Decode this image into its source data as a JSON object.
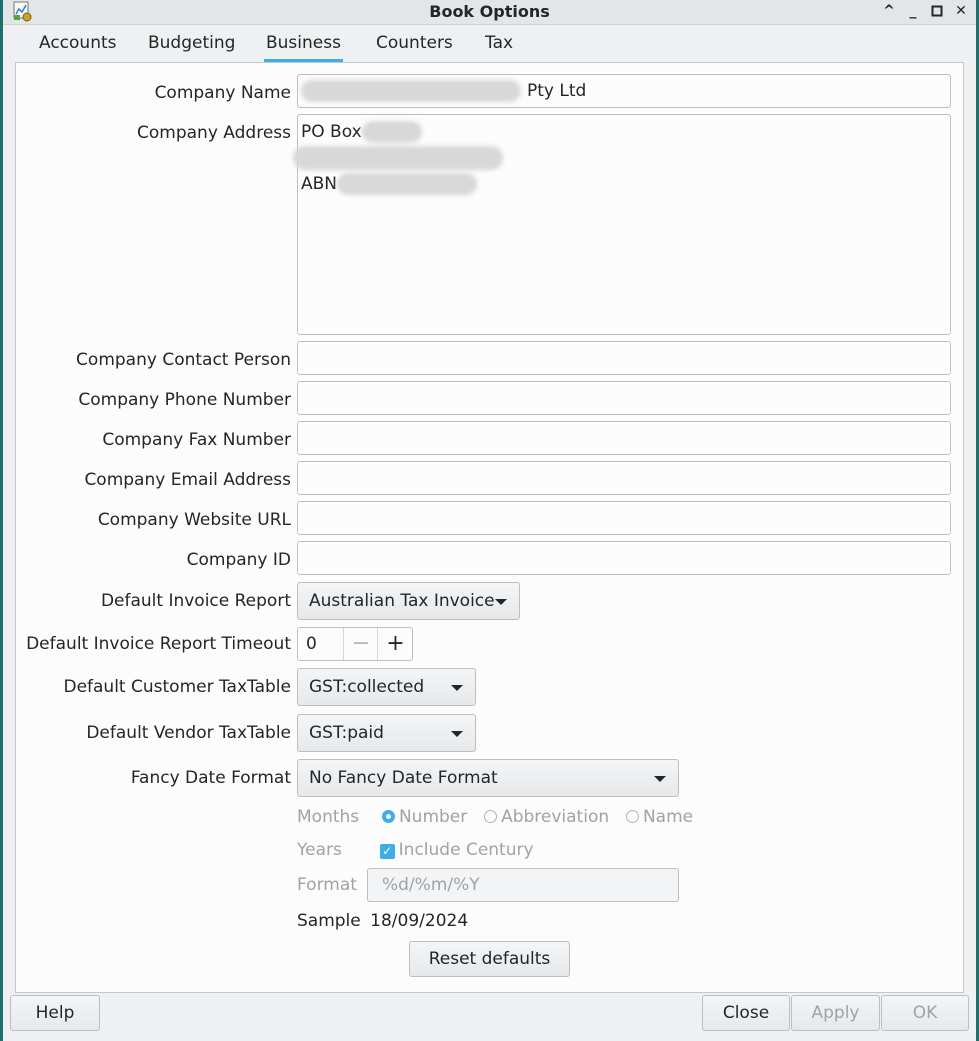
{
  "window": {
    "title": "Book Options"
  },
  "tabs": [
    {
      "label": "Accounts"
    },
    {
      "label": "Budgeting"
    },
    {
      "label": "Business"
    },
    {
      "label": "Counters"
    },
    {
      "label": "Tax"
    }
  ],
  "business": {
    "company_name_label": "Company Name",
    "company_name_value": "Pty Ltd",
    "company_address_label": "Company Address",
    "address_line1": "PO Box",
    "address_line3": "ABN",
    "contact_person_label": "Company Contact Person",
    "phone_label": "Company Phone Number",
    "fax_label": "Company Fax Number",
    "email_label": "Company Email Address",
    "website_label": "Company Website URL",
    "company_id_label": "Company ID",
    "default_invoice_report_label": "Default Invoice Report",
    "default_invoice_report_value": "Australian Tax Invoice",
    "invoice_timeout_label": "Default Invoice Report Timeout",
    "invoice_timeout_value": "0",
    "customer_taxtable_label": "Default Customer TaxTable",
    "customer_taxtable_value": "GST:collected",
    "vendor_taxtable_label": "Default Vendor TaxTable",
    "vendor_taxtable_value": "GST:paid",
    "fancy_date_label": "Fancy Date Format",
    "fancy_date_value": "No Fancy Date Format",
    "months_label": "Months",
    "months_options": {
      "number": "Number",
      "abbreviation": "Abbreviation",
      "name": "Name"
    },
    "months_selected": "Number",
    "years_label": "Years",
    "include_century_label": "Include Century",
    "include_century_checked": true,
    "format_label": "Format",
    "format_value": "%d/%m/%Y",
    "sample_label": "Sample",
    "sample_value": "18/09/2024",
    "reset_defaults_label": "Reset defaults"
  },
  "footer": {
    "help_label": "Help",
    "close_label": "Close",
    "apply_label": "Apply",
    "ok_label": "OK"
  },
  "colors": {
    "accent": "#3daee9",
    "window_bg": "#eff0f1",
    "page_bg": "#fcfcfc"
  }
}
